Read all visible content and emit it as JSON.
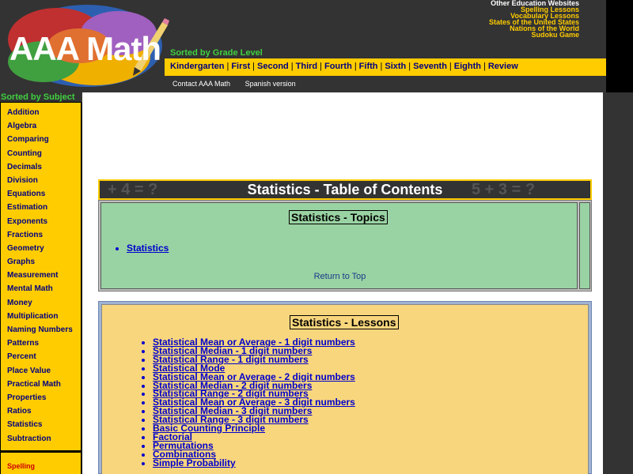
{
  "header": {
    "logo_text": "AAA Math",
    "sorted_by_grade": "Sorted by Grade Level",
    "grade_links": [
      "Kindergarten",
      "First",
      "Second",
      "Third",
      "Fourth",
      "Fifth",
      "Sixth",
      "Seventh",
      "Eighth",
      "Review"
    ],
    "contact_links": [
      "Contact AAA Math",
      "Spanish version"
    ],
    "other_sites_heading": "Other Education Websites",
    "other_sites": [
      "Spelling Lessons",
      "Vocabulary Lessons",
      "States of the United States",
      "Nations of the World",
      "Sudoku Game"
    ]
  },
  "sidebar": {
    "heading": "Sorted by Subject",
    "items": [
      "Addition",
      "Algebra",
      "Comparing",
      "Counting",
      "Decimals",
      "Division",
      "Equations",
      "Estimation",
      "Exponents",
      "Fractions",
      "Geometry",
      "Graphs",
      "Measurement",
      "Mental Math",
      "Money",
      "Multiplication",
      "Naming Numbers",
      "Patterns",
      "Percent",
      "Place Value",
      "Practical Math",
      "Properties",
      "Ratios",
      "Statistics",
      "Subtraction"
    ],
    "extra": "Spelling"
  },
  "main": {
    "toc_title": "Statistics - Table of Contents",
    "topics_heading": "Statistics - Topics",
    "topics": [
      "Statistics"
    ],
    "return_to_top": "Return to Top",
    "lessons_heading": "Statistics - Lessons",
    "lessons": [
      "Statistical Mean or Average - 1 digit numbers",
      "Statistical Median - 1 digit numbers",
      "Statistical Range - 1 digit numbers",
      "Statistical Mode",
      "Statistical Mean or Average - 2 digit numbers",
      "Statistical Median - 2 digit numbers",
      "Statistical Range - 2 digit numbers",
      "Statistical Mean or Average - 3 digit numbers",
      "Statistical Median - 3 digit numbers",
      "Statistical Range - 3 digit numbers",
      "Basic Counting Principle",
      "Factorial",
      "Permutations",
      "Combinations",
      "Simple Probability"
    ]
  },
  "colors": {
    "header_bg": "#333333",
    "accent_yellow": "#ffcc00",
    "link_blue": "#0000cc",
    "green_heading": "#40d040",
    "topics_bg": "#99d3a3",
    "lessons_bg": "#f8d67d"
  }
}
